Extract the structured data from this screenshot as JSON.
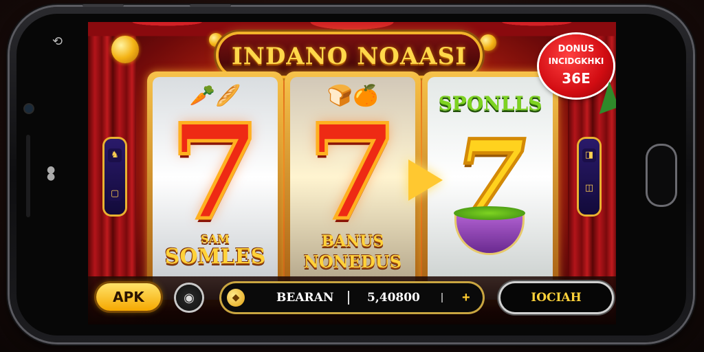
{
  "game": {
    "title": "INDANO NOAASI",
    "bonus_badge": {
      "line1": "DONUS",
      "line2": "INCIDGKHKI",
      "line3": "36E"
    }
  },
  "reels": [
    {
      "symbol": "7",
      "label_small": "SAM",
      "label": "SOMLES"
    },
    {
      "symbol": "7",
      "label_small": "BANUS",
      "label": "NONEDUS"
    },
    {
      "symbol": "7",
      "header": "SPONLLS"
    }
  ],
  "controls": {
    "apk_label": "APK",
    "balance_label": "BEARAN",
    "balance_value": "5,40800",
    "plus_label": "+",
    "right_button_label": "IOCIAH"
  },
  "side_left": {
    "icons": [
      "♞",
      "▢"
    ]
  },
  "side_right": {
    "icons": [
      "◨",
      "◫"
    ]
  },
  "icons": {
    "rotate": "rotate-icon",
    "coin": "coin-icon",
    "round_button": "power-icon"
  },
  "colors": {
    "accent_gold": "#ffd23a",
    "seven_red": "#ee2a14",
    "seven_yellow": "#ffd21e"
  }
}
